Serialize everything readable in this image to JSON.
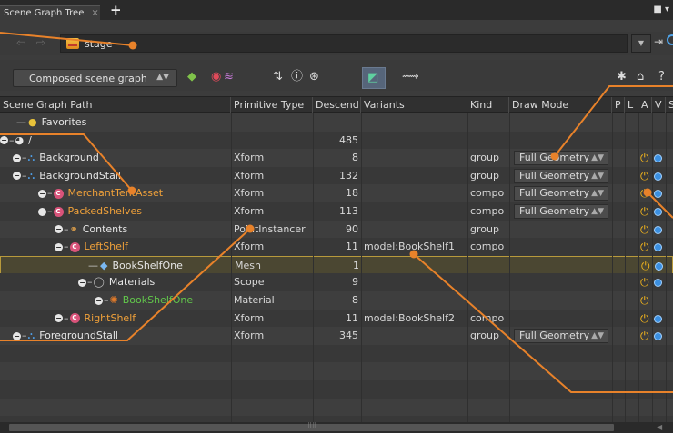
{
  "tab": {
    "title": "Scene Graph Tree",
    "close": "×",
    "add": "+"
  },
  "pathbar": {
    "path": "stage",
    "back": "⇦",
    "forward": "⇨"
  },
  "toolbar": {
    "combo_label": "Composed scene graph"
  },
  "columns": [
    "Scene Graph Path",
    "Primitive Type",
    "Descend",
    "Variants",
    "Kind",
    "Draw Mode",
    "P",
    "L",
    "A",
    "V",
    "S"
  ],
  "rows": [
    {
      "name": "Favorites",
      "type": "",
      "descend": "",
      "variants": "",
      "kind": "",
      "draw_mode": "",
      "name_color": "white",
      "power": false,
      "eye": false
    },
    {
      "name": "/",
      "type": "",
      "descend": "485",
      "variants": "",
      "kind": "",
      "draw_mode": "",
      "name_color": "white",
      "power": false,
      "eye": false
    },
    {
      "name": "Background",
      "type": "Xform",
      "descend": "8",
      "variants": "",
      "kind": "group",
      "draw_mode": "Full Geometry",
      "name_color": "white",
      "power": true,
      "eye": true
    },
    {
      "name": "BackgroundStall",
      "type": "Xform",
      "descend": "132",
      "variants": "",
      "kind": "group",
      "draw_mode": "Full Geometry",
      "name_color": "white",
      "power": true,
      "eye": true
    },
    {
      "name": "MerchantTentAsset",
      "type": "Xform",
      "descend": "18",
      "variants": "",
      "kind": "compo",
      "draw_mode": "Full Geometry",
      "name_color": "orange",
      "power": true,
      "eye": true
    },
    {
      "name": "PackedShelves",
      "type": "Xform",
      "descend": "113",
      "variants": "",
      "kind": "compo",
      "draw_mode": "Full Geometry",
      "name_color": "orange",
      "power": true,
      "eye": true
    },
    {
      "name": "Contents",
      "type": "PointInstancer",
      "descend": "90",
      "variants": "",
      "kind": "group",
      "draw_mode": "",
      "name_color": "white",
      "power": true,
      "eye": true
    },
    {
      "name": "LeftShelf",
      "type": "Xform",
      "descend": "11",
      "variants": "model:BookShelf1",
      "kind": "compo",
      "draw_mode": "",
      "name_color": "orange",
      "power": true,
      "eye": true
    },
    {
      "name": "BookShelfOne",
      "type": "Mesh",
      "descend": "1",
      "variants": "",
      "kind": "",
      "draw_mode": "",
      "name_color": "white",
      "power": true,
      "eye": true
    },
    {
      "name": "Materials",
      "type": "Scope",
      "descend": "9",
      "variants": "",
      "kind": "",
      "draw_mode": "",
      "name_color": "white",
      "power": true,
      "eye": true
    },
    {
      "name": "BookShelfOne",
      "type": "Material",
      "descend": "8",
      "variants": "",
      "kind": "",
      "draw_mode": "",
      "name_color": "green",
      "power": true,
      "eye": false
    },
    {
      "name": "RightShelf",
      "type": "Xform",
      "descend": "11",
      "variants": "model:BookShelf2",
      "kind": "compo",
      "draw_mode": "",
      "name_color": "orange",
      "power": true,
      "eye": true
    },
    {
      "name": "ForegroundStall",
      "type": "Xform",
      "descend": "345",
      "variants": "",
      "kind": "group",
      "draw_mode": "Full Geometry",
      "name_color": "white",
      "power": true,
      "eye": true
    }
  ],
  "selected_row": 8,
  "colors": {
    "accent_orange": "#f0a13a",
    "annotation": "#e8822a",
    "selection_border": "#b89a3c",
    "prim_green": "#62c84b",
    "xform_blue": "#4f9fe8"
  }
}
